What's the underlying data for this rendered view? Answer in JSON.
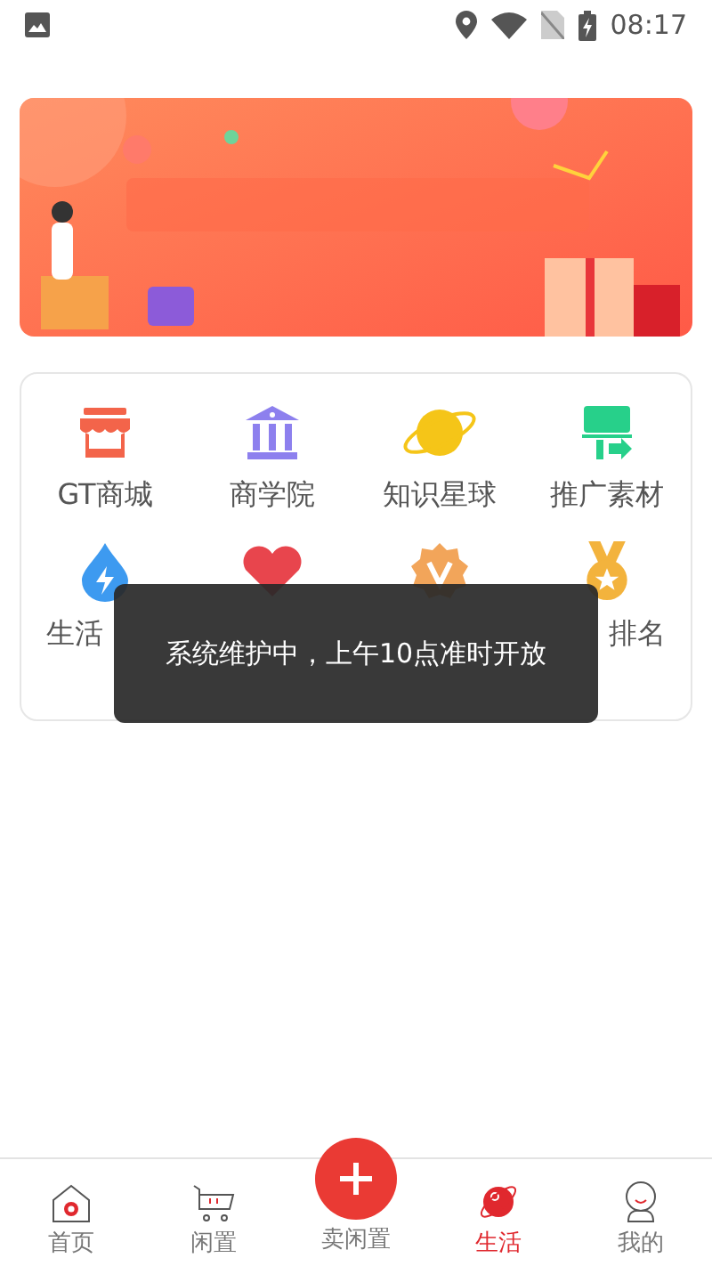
{
  "status_bar": {
    "time": "08:17"
  },
  "services": [
    {
      "label": "GT商城",
      "kind": "shop"
    },
    {
      "label": "商学院",
      "kind": "bank"
    },
    {
      "label": "知识星球",
      "kind": "planet"
    },
    {
      "label": "推广素材",
      "kind": "board"
    },
    {
      "label": "生活",
      "kind": "drop"
    },
    {
      "kind": "heart"
    },
    {
      "kind": "badge"
    },
    {
      "label": "排名",
      "kind": "medal"
    }
  ],
  "toast": "系统维护中，上午10点准时开放",
  "tabs": [
    {
      "label": "首页",
      "kind": "home",
      "selected": false
    },
    {
      "label": "闲置",
      "kind": "cart",
      "selected": false
    },
    {
      "label": "卖闲置",
      "kind": "plus",
      "selected": false
    },
    {
      "label": "生活",
      "kind": "planet",
      "selected": true
    },
    {
      "label": "我的",
      "kind": "person",
      "selected": false
    }
  ]
}
